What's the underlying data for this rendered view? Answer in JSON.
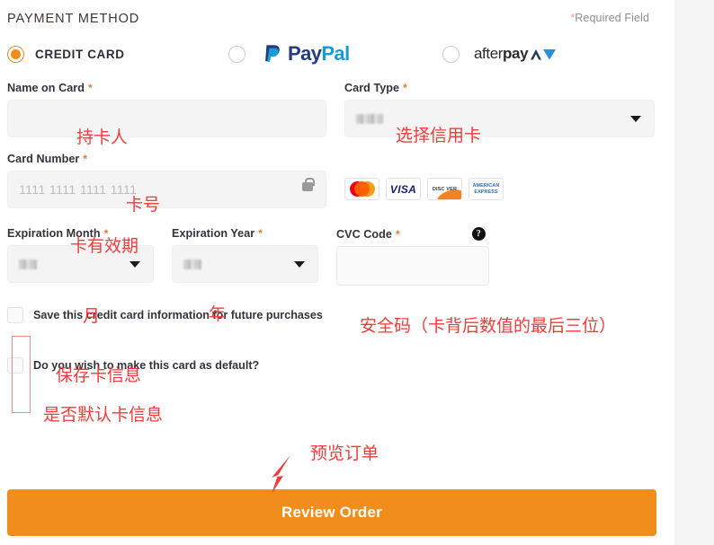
{
  "header": {
    "section_title": "PAYMENT METHOD",
    "required_note": "Required Field",
    "required_star": "*"
  },
  "payment_methods": [
    {
      "id": "credit-card",
      "label": "CREDIT CARD",
      "selected": true
    },
    {
      "id": "paypal",
      "label_a": "Pay",
      "label_b": "Pal",
      "selected": false
    },
    {
      "id": "afterpay",
      "label_a": "after",
      "label_b": "pay",
      "selected": false
    }
  ],
  "fields": {
    "name_on_card": {
      "label": "Name on Card",
      "required": "*",
      "value": ""
    },
    "card_type": {
      "label": "Card Type",
      "required": "*",
      "value": ""
    },
    "card_number": {
      "label": "Card Number",
      "required": "*",
      "placeholder": "1111 1111 1111 1111",
      "value": ""
    },
    "expiration_month": {
      "label": "Expiration Month",
      "required": "*",
      "value": ""
    },
    "expiration_year": {
      "label": "Expiration Year",
      "required": "*",
      "value": ""
    },
    "cvc_code": {
      "label": "CVC Code",
      "required": "*",
      "value": "",
      "help_glyph": "?"
    }
  },
  "accepted_cards": [
    {
      "name": "mastercard-logo",
      "text": ""
    },
    {
      "name": "visa-logo",
      "text": "VISA"
    },
    {
      "name": "discover-logo",
      "text": "DISC VER"
    },
    {
      "name": "amex-logo",
      "line1": "AMERICAN",
      "line2": "EXPRESS"
    }
  ],
  "checkboxes": [
    {
      "id": "save-card",
      "label": "Save this credit card information for future purchases",
      "checked": false
    },
    {
      "id": "default-card",
      "label": "Do you wish to make this card as default?",
      "checked": false
    }
  ],
  "actions": {
    "review_order": "Review Order"
  },
  "annotations": [
    {
      "id": "name-on-card",
      "text": "持卡人"
    },
    {
      "id": "card-type",
      "text": "选择信用卡"
    },
    {
      "id": "card-number",
      "text": "卡号"
    },
    {
      "id": "expiration",
      "text": "卡有效期"
    },
    {
      "id": "month",
      "text": "月"
    },
    {
      "id": "year",
      "text": "年"
    },
    {
      "id": "cvc",
      "text": "安全码（卡背后数值的最后三位）"
    },
    {
      "id": "save-card",
      "text": "保存卡信息"
    },
    {
      "id": "default-card",
      "text": "是否默认卡信息"
    },
    {
      "id": "review-order",
      "text": "预览订单"
    }
  ],
  "colors": {
    "accent": "#f18d1c",
    "annotation": "#f03b3b",
    "paypal_dark": "#253b80",
    "paypal_light": "#179bd7",
    "page_bg": "#ffffff",
    "gutter_bg": "#f5f5f5"
  }
}
